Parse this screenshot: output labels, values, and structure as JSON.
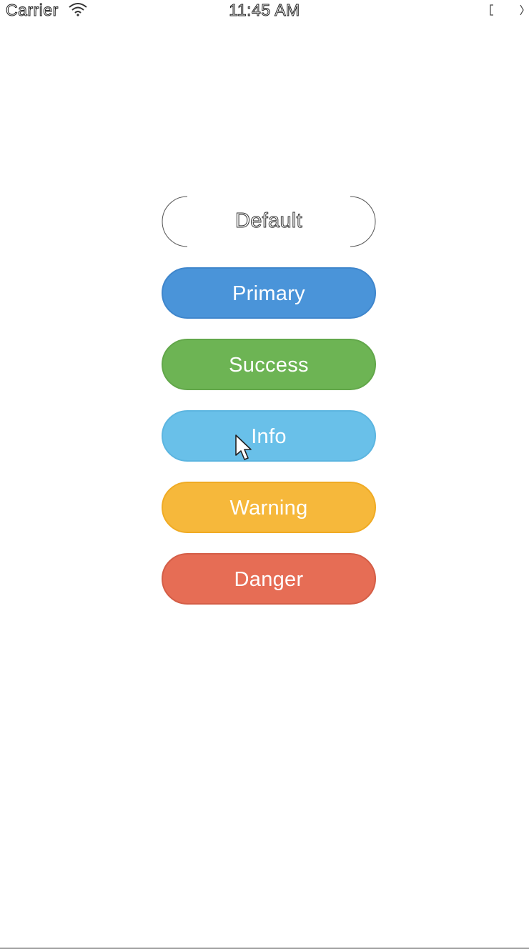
{
  "status_bar": {
    "carrier": "Carrier",
    "time": "11:45 AM",
    "icons": [
      "wifi-icon",
      "battery-icon"
    ]
  },
  "buttons": {
    "default": "Default",
    "primary": "Primary",
    "success": "Success",
    "info": "Info",
    "warning": "Warning",
    "danger": "Danger"
  },
  "colors": {
    "primary": "#4a94d9",
    "success": "#6db454",
    "info": "#69c0e9",
    "warning": "#f6b83b",
    "danger": "#e66d55"
  }
}
